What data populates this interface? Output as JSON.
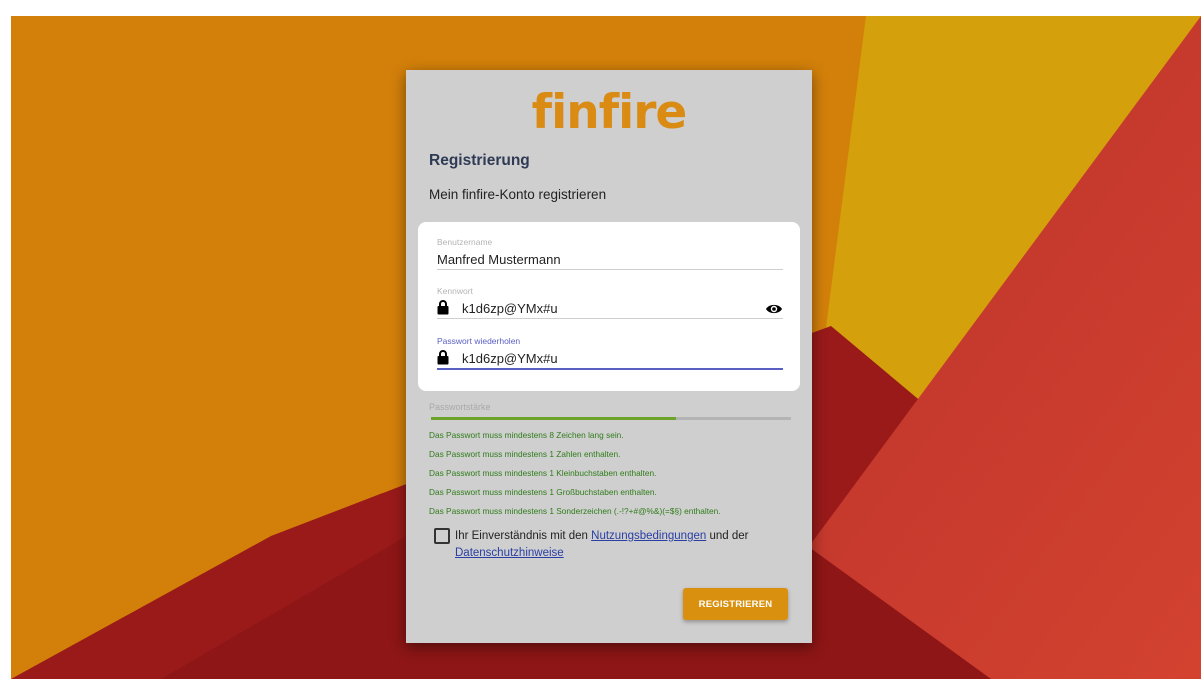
{
  "app": {
    "logo_text": "finfire",
    "colors": {
      "brand": "#d98b14",
      "accent": "#5a5fc4",
      "success": "#2f7d19",
      "button": "#d9900f"
    }
  },
  "card": {
    "title": "Registrierung",
    "subtitle": "Mein finfire-Konto registrieren"
  },
  "form": {
    "username": {
      "label": "Benutzername",
      "value": "Manfred Mustermann"
    },
    "password": {
      "label": "Kennwort",
      "value": "k1d6zp@YMx#u",
      "icon": "lock-icon",
      "toggle_icon": "eye-icon"
    },
    "password_repeat": {
      "label": "Passwort wiederholen",
      "value": "k1d6zp@YMx#u",
      "icon": "lock-icon"
    }
  },
  "strength": {
    "label": "Passwortstärke",
    "level": 0.68,
    "rules": [
      "Das Passwort muss mindestens 8 Zeichen lang sein.",
      "Das Passwort muss mindestens 1 Zahlen enthalten.",
      "Das Passwort muss mindestens 1 Kleinbuchstaben enthalten.",
      "Das Passwort muss mindestens 1 Großbuchstaben enthalten.",
      "Das Passwort muss mindestens 1 Sonderzeichen (.-!?+#@%&)(=$§) enthalten."
    ]
  },
  "consent": {
    "checked": false,
    "text_before": "Ihr Einverständnis mit den ",
    "terms_link": "Nutzungsbedingungen",
    "text_middle": " und der",
    "privacy_link": "Datenschutzhinweise"
  },
  "actions": {
    "register_label": "REGISTRIEREN"
  }
}
